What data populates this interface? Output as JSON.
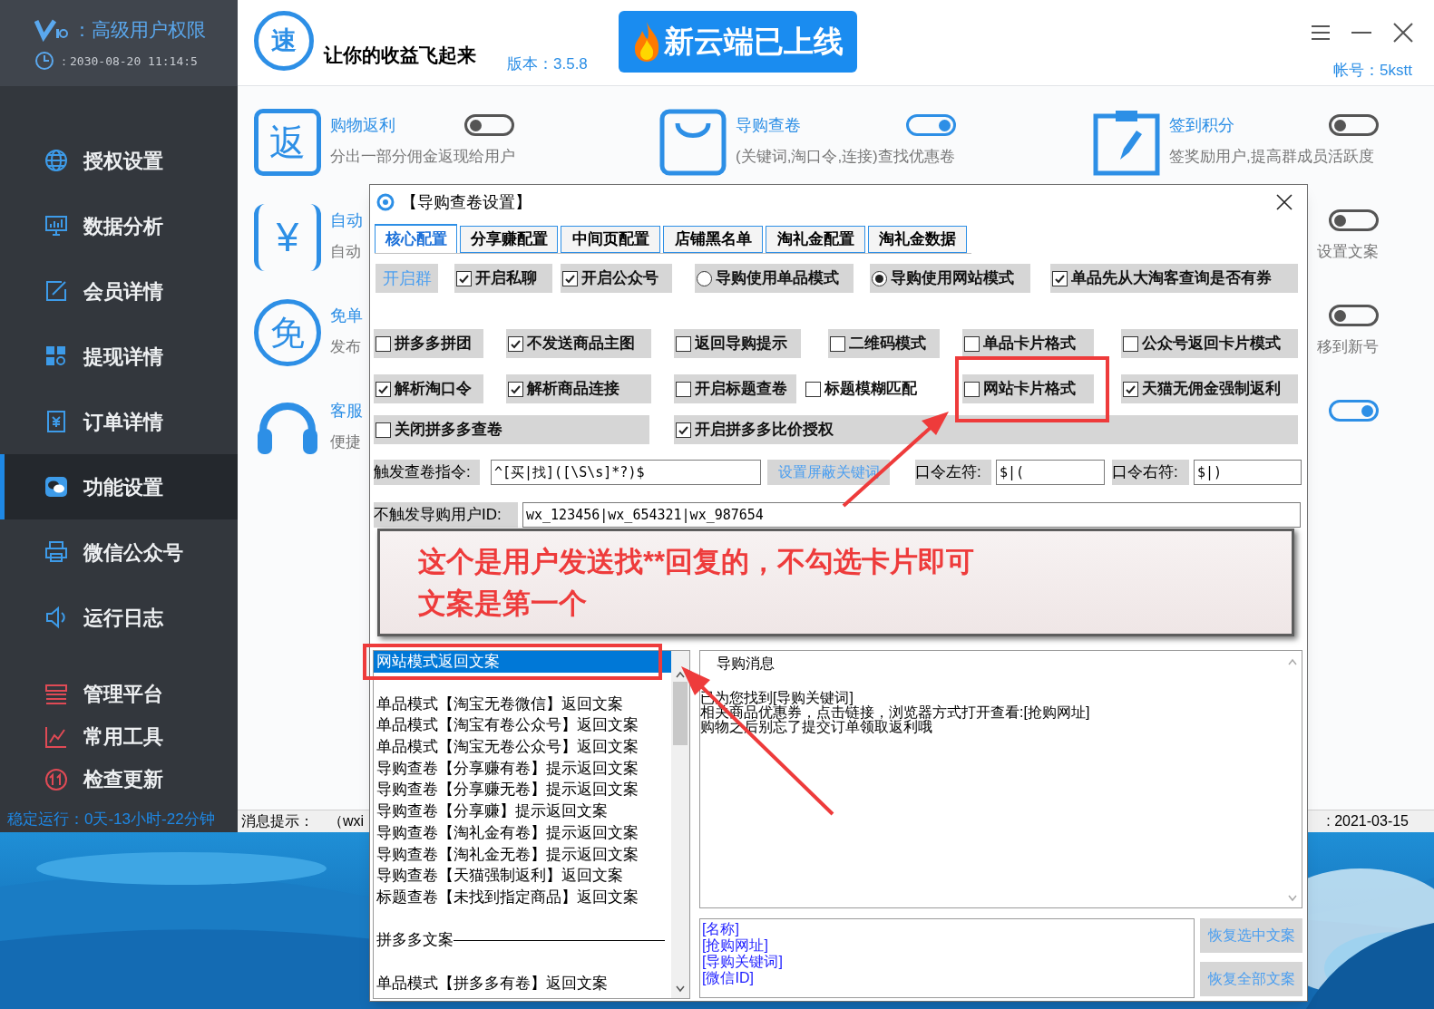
{
  "sidebar": {
    "badge": "：高级用户权限",
    "clock": "：2030-08-20 11:14:5",
    "nav": [
      {
        "label": "授权设置",
        "selected": false
      },
      {
        "label": "数据分析",
        "selected": false
      },
      {
        "label": "会员详情",
        "selected": false
      },
      {
        "label": "提现详情",
        "selected": false
      },
      {
        "label": "订单详情",
        "selected": false
      },
      {
        "label": "功能设置",
        "selected": true
      },
      {
        "label": "微信公众号",
        "selected": false
      },
      {
        "label": "运行日志",
        "selected": false
      }
    ],
    "tools": [
      {
        "label": "管理平台",
        "selected": false
      },
      {
        "label": "常用工具",
        "selected": false
      },
      {
        "label": "检查更新",
        "selected": false
      }
    ],
    "uptime": "稳定运行：0天-13小时-22分钟"
  },
  "header": {
    "logo_text": "速",
    "slogan": "让你的收益飞起来",
    "version": "版本：3.5.8",
    "banner": "新云端已上线",
    "account": "帐号：5kstt"
  },
  "features": [
    {
      "left": {
        "icon_text": "返",
        "title": "购物返利",
        "desc": "分出一部分佣金返现给用户",
        "on": false
      },
      "middle": {
        "title": "导购查卷",
        "desc": "(关键词,淘口令,连接)查找优惠卷",
        "on": true
      },
      "right": {
        "title": "签到积分",
        "desc": "签奖励用户,提高群成员活跃度",
        "on": false
      }
    },
    {
      "left": {
        "icon_text": "¥",
        "title": "自动",
        "desc": "自动"
      },
      "right": {
        "desc": "设置文案",
        "on": false
      }
    },
    {
      "left": {
        "icon_text": "免",
        "title": "免单",
        "desc": "发布"
      },
      "right": {
        "desc": "移到新号",
        "on": false
      }
    },
    {
      "left": {
        "title": "客服",
        "desc": "便捷"
      },
      "right": {
        "on": true
      }
    }
  ],
  "status_bar": {
    "label": "消息提示：",
    "message": "（wxi",
    "date": ": 2021-03-15"
  },
  "dialog": {
    "title": "【导购查卷设置】",
    "tabs": [
      {
        "label": "核心配置",
        "selected": true
      },
      {
        "label": "分享赚配置",
        "selected": false
      },
      {
        "label": "中间页配置",
        "selected": false
      },
      {
        "label": "店铺黑名单",
        "selected": false
      },
      {
        "label": "淘礼金配置",
        "selected": false
      },
      {
        "label": "淘礼金数据",
        "selected": false
      }
    ],
    "option_rows": [
      [
        {
          "kind": "button",
          "label": "开启群"
        },
        {
          "kind": "checkbox",
          "label": "开启私聊",
          "checked": true
        },
        {
          "kind": "checkbox",
          "label": "开启公众号",
          "checked": true
        },
        {
          "kind": "radio",
          "label": "导购使用单品模式",
          "checked": false
        },
        {
          "kind": "radio",
          "label": "导购使用网站模式",
          "checked": true
        },
        {
          "kind": "checkbox",
          "label": "单品先从大淘客查询是否有券",
          "checked": true
        }
      ],
      [
        {
          "kind": "checkbox",
          "label": "拼多多拼团",
          "checked": false
        },
        {
          "kind": "checkbox",
          "label": "不发送商品主图",
          "checked": true
        },
        {
          "kind": "checkbox",
          "label": "返回导购提示",
          "checked": false
        },
        {
          "kind": "checkbox",
          "label": "二维码模式",
          "checked": false
        },
        {
          "kind": "checkbox",
          "label": "单品卡片格式",
          "checked": false
        },
        {
          "kind": "checkbox",
          "label": "公众号返回卡片模式",
          "checked": false
        }
      ],
      [
        {
          "kind": "checkbox",
          "label": "解析淘口令",
          "checked": true
        },
        {
          "kind": "checkbox",
          "label": "解析商品连接",
          "checked": true
        },
        {
          "kind": "checkbox",
          "label": "开启标题查卷",
          "checked": false
        },
        {
          "kind": "checkbox",
          "label": "标题模糊匹配",
          "checked": false
        },
        {
          "kind": "checkbox",
          "label": "网站卡片格式",
          "checked": false
        },
        {
          "kind": "checkbox",
          "label": "天猫无佣金强制返利",
          "checked": true
        }
      ],
      [
        {
          "kind": "checkbox",
          "label": "关闭拼多多查卷",
          "checked": false
        },
        {
          "kind": "checkbox",
          "label": "开启拼多多比价授权",
          "checked": true
        }
      ]
    ],
    "trigger": {
      "label": "触发查卷指令:",
      "value": "^[买|找]([\\S\\s]*?)$"
    },
    "block_button": "设置屏蔽关键词",
    "left_symbol": {
      "label": "口令左符:",
      "value": "$|("
    },
    "right_symbol": {
      "label": "口令右符:",
      "value": "$|)"
    },
    "exclude_ids": {
      "label": "不触发导购用户ID:",
      "value": "wx_123456|wx_654321|wx_987654"
    },
    "templates": [
      {
        "kind": "item",
        "label": "网站模式返回文案",
        "selected": true
      },
      {
        "kind": "item",
        "label": "单品模式【淘宝无卷微信】返回文案",
        "selected": false
      },
      {
        "kind": "item",
        "label": "单品模式【淘宝有卷公众号】返回文案",
        "selected": false
      },
      {
        "kind": "item",
        "label": "单品模式【淘宝无卷公众号】返回文案",
        "selected": false
      },
      {
        "kind": "item",
        "label": "导购查卷【分享赚有卷】提示返回文案",
        "selected": false
      },
      {
        "kind": "item",
        "label": "导购查卷【分享赚无卷】提示返回文案",
        "selected": false
      },
      {
        "kind": "item",
        "label": "导购查卷【分享赚】提示返回文案",
        "selected": false
      },
      {
        "kind": "item",
        "label": "导购查卷【淘礼金有卷】提示返回文案",
        "selected": false
      },
      {
        "kind": "item",
        "label": "导购查卷【淘礼金无卷】提示返回文案",
        "selected": false
      },
      {
        "kind": "item",
        "label": "导购查卷【天猫强制返利】返回文案",
        "selected": false
      },
      {
        "kind": "item",
        "label": "标题查卷【未找到指定商品】返回文案",
        "selected": false
      },
      {
        "kind": "heading",
        "label": "拼多多文案"
      },
      {
        "kind": "item",
        "label": "单品模式【拼多多有卷】返回文案",
        "selected": false
      }
    ],
    "message_title": "导购消息",
    "message_lines": [
      "已为您找到[导购关键词]",
      "相关商品优惠券，点击链接，浏览器方式打开查看:[抢购网址]",
      "购物之后别忘了提交订单领取返利哦"
    ],
    "variables": [
      "[名称]",
      "[抢购网址]",
      "[导购关键词]",
      "[微信ID]"
    ],
    "buttons": [
      "恢复选中文案",
      "恢复全部文案"
    ]
  },
  "annotation": {
    "lines": [
      "这个是用户发送找**回复的，不勾选卡片即可",
      "文案是第一个"
    ]
  }
}
